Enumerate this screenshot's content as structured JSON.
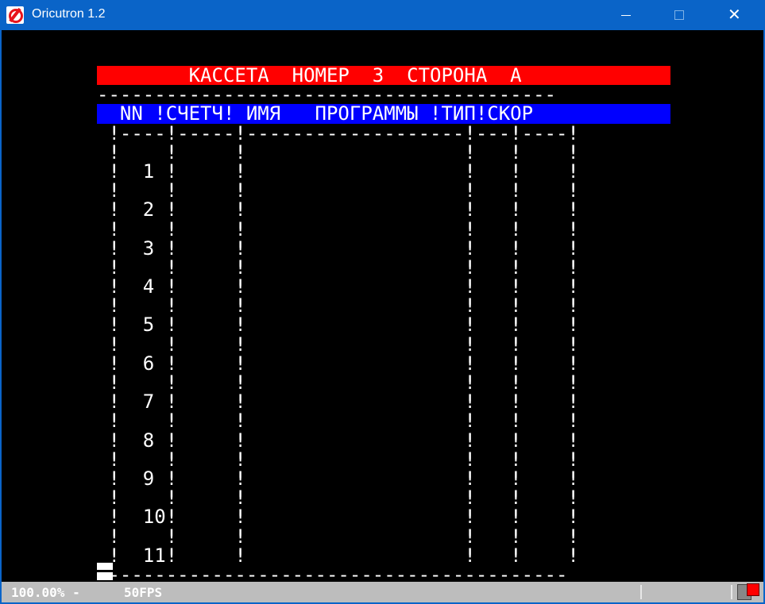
{
  "window": {
    "title": "Oricutron 1.2",
    "minimize_glyph": "minimize",
    "maximize_glyph": "maximize",
    "close_glyph": "✕"
  },
  "screen": {
    "lines": [
      "        КАССЕТА  НОМЕР  3  СТОРОНА  А   ",
      "----------------------------------------",
      "  NN !СЧЕТЧ! ИМЯ   ПРОГРАММЫ !ТИП!СКОР  ",
      " !----!-----!-------------------!---!----!",
      " !    !     !                   !   !    !",
      " !  1 !     !                   !   !    !",
      " !    !     !                   !   !    !",
      " !  2 !     !                   !   !    !",
      " !    !     !                   !   !    !",
      " !  3 !     !                   !   !    !",
      " !    !     !                   !   !    !",
      " !  4 !     !                   !   !    !",
      " !    !     !                   !   !    !",
      " !  5 !     !                   !   !    !",
      " !    !     !                   !   !    !",
      " !  6 !     !                   !   !    !",
      " !    !     !                   !   !    !",
      " !  7 !     !                   !   !    !",
      " !    !     !                   !   !    !",
      " !  8 !     !                   !   !    !",
      " !    !     !                   !   !    !",
      " !  9 !     !                   !   !    !",
      " !    !     !                   !   !    !",
      " !  10!     !                   !   !    !",
      " !    !     !                   !   !    !",
      " !  11!     !                   !   !    !",
      " ----------------------------------------"
    ],
    "line_backgrounds": [
      "red",
      "",
      "blue"
    ],
    "colors": {
      "background": "#000000",
      "text": "#ffffff",
      "title_bar": "#ff0000",
      "header_bar": "#0000ff"
    }
  },
  "statusbar": {
    "speed": "100.00% -",
    "fps": "50FPS",
    "tape_icon": "tape-icon",
    "led_color": "#ff0000"
  }
}
